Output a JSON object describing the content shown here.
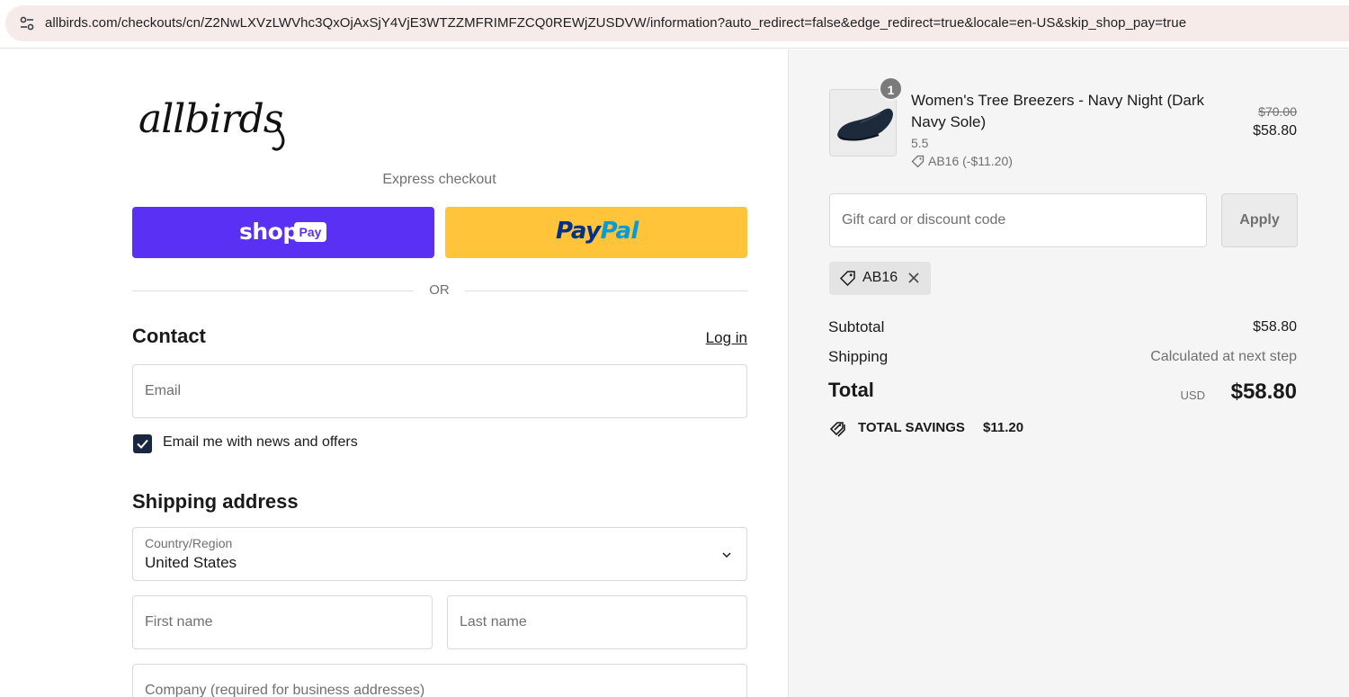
{
  "browser": {
    "url": "allbirds.com/checkouts/cn/Z2NwLXVzLWVhc3QxOjAxSjY4VjE3WTZZMFRIMFZCQ0REWjZUSDVW/information?auto_redirect=false&edge_redirect=true&locale=en-US&skip_shop_pay=true",
    "site_info_icon": "tune-icon"
  },
  "brand": {
    "logo_text": "allbirds"
  },
  "express": {
    "label": "Express checkout",
    "shop_pay": {
      "word": "shop",
      "badge": "Pay",
      "color": "#5a31f4"
    },
    "paypal": {
      "part1": "Pay",
      "part2": "Pal",
      "color": "#ffc439"
    },
    "or": "OR"
  },
  "contact": {
    "heading": "Contact",
    "login": "Log in",
    "email_placeholder": "Email",
    "newsletter_label": "Email me with news and offers",
    "newsletter_checked": true
  },
  "shipping": {
    "heading": "Shipping address",
    "country_label": "Country/Region",
    "country_value": "United States",
    "first_name_placeholder": "First name",
    "last_name_placeholder": "Last name",
    "company_placeholder": "Company (required for business addresses)"
  },
  "order": {
    "item": {
      "quantity": "1",
      "name": "Women's Tree Breezers - Navy Night (Dark Navy Sole)",
      "size": "5.5",
      "discount": "AB16 (-$11.20)",
      "price_original": "$70.00",
      "price_final": "$58.80"
    },
    "gift_placeholder": "Gift card or discount code",
    "apply_label": "Apply",
    "applied_code": "AB16",
    "subtotal_label": "Subtotal",
    "subtotal_value": "$58.80",
    "shipping_label": "Shipping",
    "shipping_value": "Calculated at next step",
    "total_label": "Total",
    "total_currency": "USD",
    "total_value": "$58.80",
    "savings_label": "TOTAL SAVINGS",
    "savings_value": "$11.20"
  }
}
